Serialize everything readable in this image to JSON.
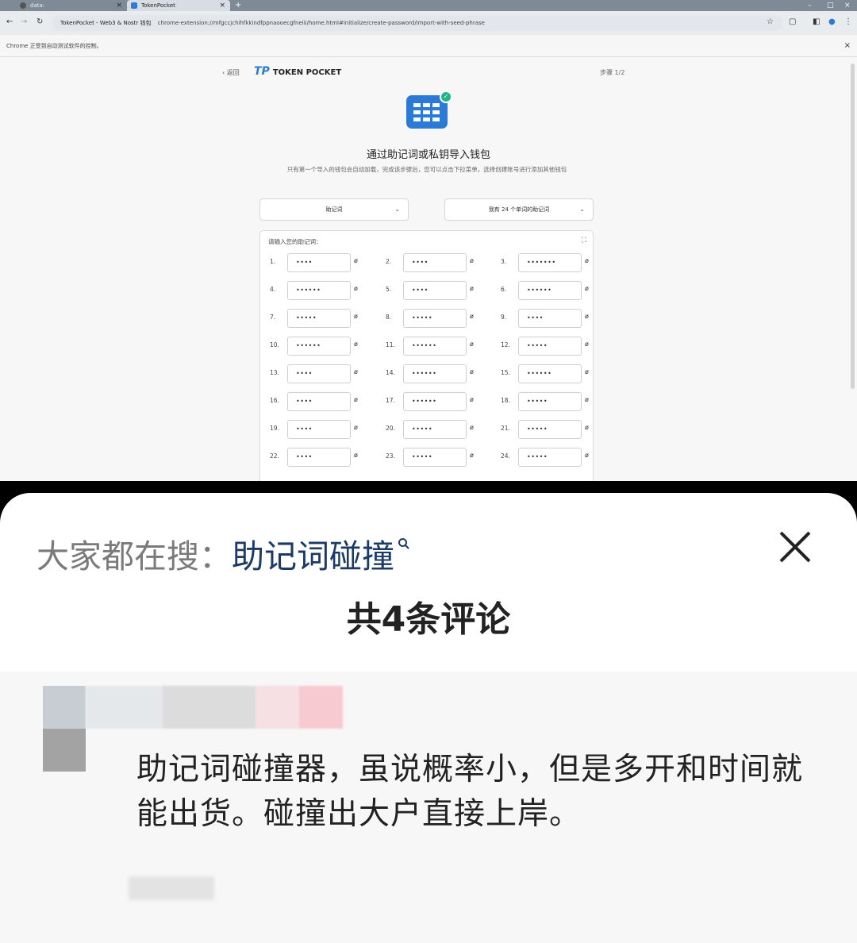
{
  "browser": {
    "tabs": [
      {
        "label": "data:"
      },
      {
        "label": "TokenPocket"
      }
    ],
    "url": {
      "site": "TokenPocket - Web3 & Nostr 钱包",
      "path": "chrome-extension://mfgccjchihfkkindfppnaooecgfneiii/home.html#initialize/create-password/import-with-seed-phrase"
    },
    "infobar": "Chrome 正受到自动测试软件的控制。",
    "page": {
      "back_label": "返回",
      "brand": "TOKEN POCKET",
      "brand_mark": "TP",
      "step": "步骤 1/2",
      "title": "通过助记词或私钥导入钱包",
      "subtitle": "只有第一个导入的钱包会自动加载，完成该步骤后，您可以点击下拉菜单，选择创建账号进行添加其他钱包",
      "select_type": "助记词",
      "select_length": "我有 24 个单词的助记词",
      "seed_label": "请输入您的助记词：",
      "seed_words": [
        {
          "n": "1.",
          "mask": "••••"
        },
        {
          "n": "2.",
          "mask": "••••"
        },
        {
          "n": "3.",
          "mask": "•••••••"
        },
        {
          "n": "4.",
          "mask": "••••••"
        },
        {
          "n": "5.",
          "mask": "••••"
        },
        {
          "n": "6.",
          "mask": "••••••"
        },
        {
          "n": "7.",
          "mask": "•••••"
        },
        {
          "n": "8.",
          "mask": "•••••"
        },
        {
          "n": "9.",
          "mask": "••••"
        },
        {
          "n": "10.",
          "mask": "••••••"
        },
        {
          "n": "11.",
          "mask": "••••••"
        },
        {
          "n": "12.",
          "mask": "•••••"
        },
        {
          "n": "13.",
          "mask": "••••"
        },
        {
          "n": "14.",
          "mask": "••••••"
        },
        {
          "n": "15.",
          "mask": "••••••"
        },
        {
          "n": "16.",
          "mask": "••••"
        },
        {
          "n": "17.",
          "mask": "••••••"
        },
        {
          "n": "18.",
          "mask": "•••••"
        },
        {
          "n": "19.",
          "mask": "••••"
        },
        {
          "n": "20.",
          "mask": "•••••"
        },
        {
          "n": "21.",
          "mask": "•••••"
        },
        {
          "n": "22.",
          "mask": "••••"
        },
        {
          "n": "23.",
          "mask": "•••••"
        },
        {
          "n": "24.",
          "mask": "•••••"
        }
      ]
    }
  },
  "sheet": {
    "search_prefix": "大家都在搜：",
    "search_term": "助记词碰撞",
    "title": "共4条评论",
    "comment": {
      "text": "助记词碰撞器，虽说概率小，但是多开和时间就能出货。碰撞出大户直接上岸。"
    }
  },
  "colors": {
    "brand_blue": "#2b7bd6",
    "search_term": "#1b3a66",
    "check_green": "#1fb38a"
  }
}
